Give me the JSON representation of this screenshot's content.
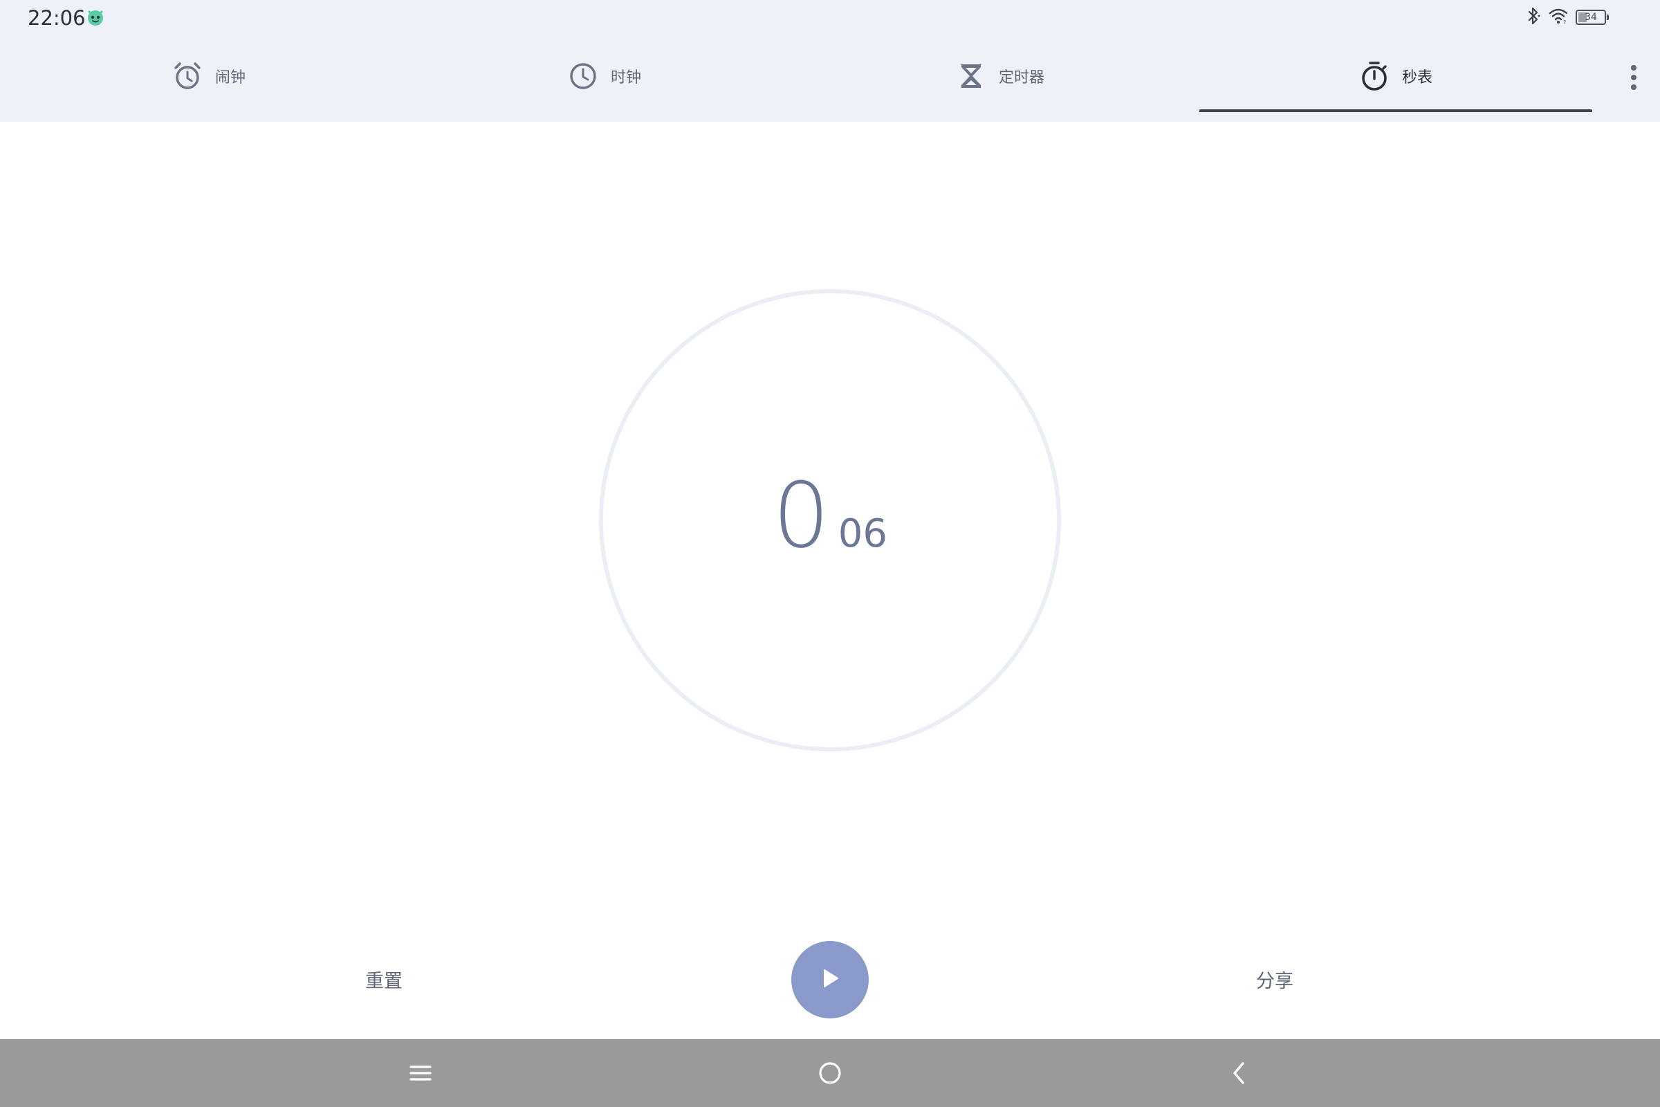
{
  "status_bar": {
    "time": "22:06",
    "battery_level": "34",
    "battery_fraction": 0.34,
    "icons": [
      "app-notification-icon",
      "bluetooth-icon",
      "wifi-icon",
      "battery-icon"
    ]
  },
  "tabs": [
    {
      "label": "闹钟",
      "icon": "alarm-icon",
      "selected": false
    },
    {
      "label": "时钟",
      "icon": "clock-icon",
      "selected": false
    },
    {
      "label": "定时器",
      "icon": "hourglass-icon",
      "selected": false
    },
    {
      "label": "秒表",
      "icon": "stopwatch-icon",
      "selected": true
    }
  ],
  "overflow_menu_icon": "more-vert-icon",
  "stopwatch": {
    "seconds": "0",
    "hundredths": "06"
  },
  "controls": {
    "reset_label": "重置",
    "share_label": "分享",
    "play_icon": "play-icon",
    "play_color": "#8a9acb"
  },
  "nav_bar": {
    "icons": [
      "menu-icon",
      "home-icon",
      "back-icon"
    ]
  },
  "colors": {
    "header_bg": "#eef1f8",
    "accent": "#3d4556",
    "readout": "#6b7794",
    "ring": "#eceef6"
  }
}
